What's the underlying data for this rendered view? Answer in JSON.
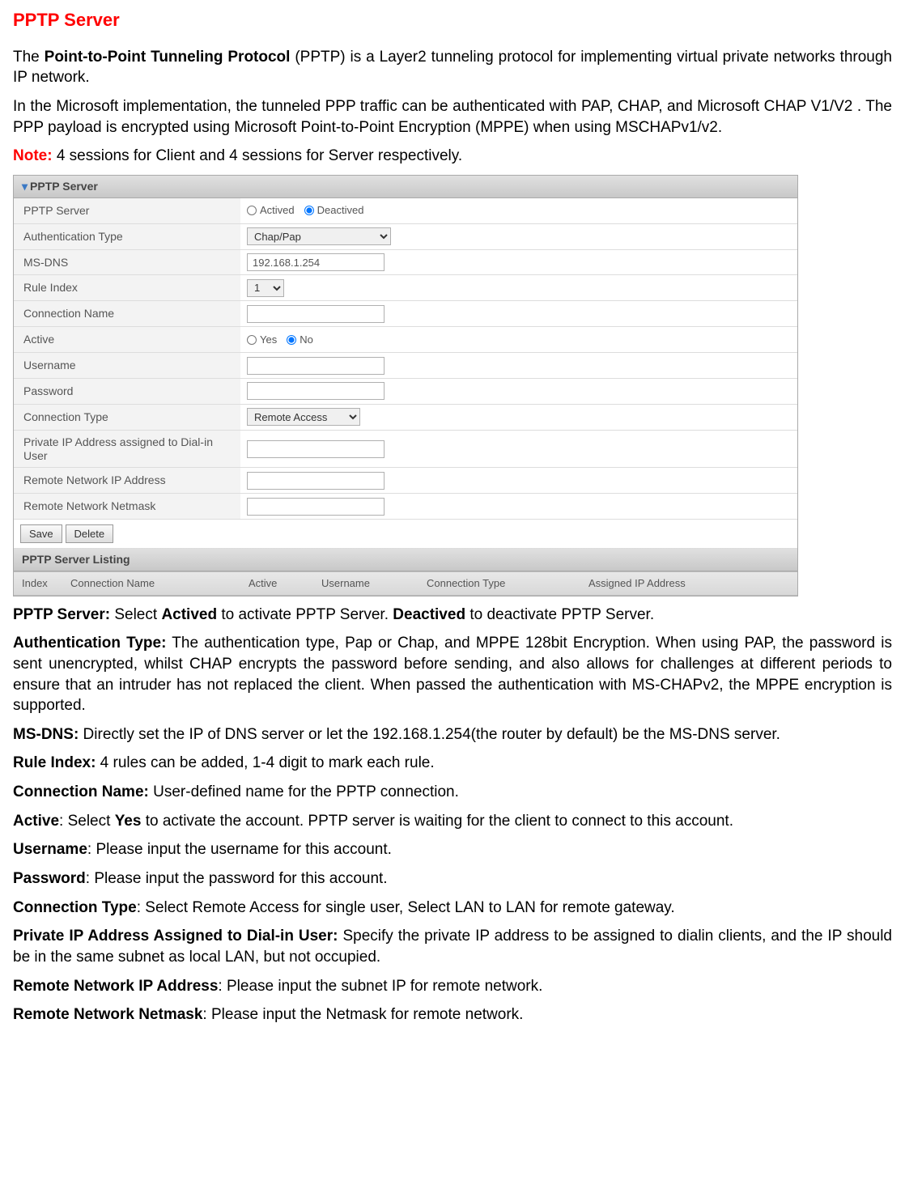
{
  "page_title": "PPTP Server",
  "intro_para1_prefix": "The ",
  "intro_para1_bold": "Point-to-Point Tunneling Protocol",
  "intro_para1_suffix": " (PPTP) is a Layer2 tunneling protocol for implementing virtual private networks through IP network.",
  "intro_para2": "In the Microsoft implementation, the tunneled PPP traffic can be authenticated with PAP, CHAP, and Microsoft CHAP V1/V2 . The PPP payload is encrypted using Microsoft Point-to-Point Encryption (MPPE) when using MSCHAPv1/v2.",
  "note_label": "Note:",
  "note_text": " 4 sessions for Client and 4 sessions for Server respectively.",
  "form": {
    "section_title": "PPTP Server",
    "rows": {
      "pptp_server_label": "PPTP Server",
      "actived_label": "Actived",
      "deactived_label": "Deactived",
      "auth_type_label": "Authentication Type",
      "auth_type_value": "Chap/Pap",
      "ms_dns_label": "MS-DNS",
      "ms_dns_value": "192.168.1.254",
      "rule_index_label": "Rule Index",
      "rule_index_value": "1",
      "connection_name_label": "Connection Name",
      "active_label": "Active",
      "yes_label": "Yes",
      "no_label": "No",
      "username_label": "Username",
      "password_label": "Password",
      "connection_type_label": "Connection Type",
      "connection_type_value": "Remote Access",
      "private_ip_label": "Private IP Address assigned to Dial-in User",
      "remote_ip_label": "Remote Network IP Address",
      "remote_netmask_label": "Remote Network Netmask"
    },
    "save_btn": "Save",
    "delete_btn": "Delete",
    "listing_title": "PPTP Server Listing",
    "table_headers": {
      "index": "Index",
      "conn_name": "Connection Name",
      "active": "Active",
      "username": "Username",
      "conn_type": "Connection Type",
      "assigned_ip": "Assigned IP Address"
    }
  },
  "descriptions": {
    "pptp_server_label": "PPTP Server:",
    "pptp_server_text1": " Select ",
    "pptp_server_bold1": "Actived",
    "pptp_server_text2": " to activate PPTP Server. ",
    "pptp_server_bold2": "Deactived",
    "pptp_server_text3": " to deactivate PPTP Server.",
    "auth_type_label": "Authentication Type:",
    "auth_type_text": " The authentication type, Pap or Chap, and MPPE 128bit Encryption. When using PAP, the password is sent unencrypted, whilst CHAP encrypts the password before sending, and also allows for challenges at different periods to ensure that an intruder has not replaced the client. When passed the authentication with MS-CHAPv2, the MPPE encryption is supported.",
    "ms_dns_label": "MS-DNS:",
    "ms_dns_text": " Directly set the IP of DNS server or let the 192.168.1.254(the router by default) be the MS-DNS server.",
    "rule_index_label": "Rule Index:",
    "rule_index_text": " 4 rules can be added, 1-4 digit to mark each rule.",
    "conn_name_label": "Connection Name:",
    "conn_name_text": " User-defined name for the PPTP connection.",
    "active_label": "Active",
    "active_text1": ": Select ",
    "active_bold1": "Yes",
    "active_text2": " to activate the account. PPTP server is waiting for the client to connect to this account.",
    "username_label": "Username",
    "username_text": ": Please input the username for this account.",
    "password_label": "Password",
    "password_text": ": Please input the password for this account.",
    "conn_type_label": "Connection Type",
    "conn_type_text": ": Select Remote Access for single user, Select LAN to LAN for remote gateway.",
    "private_ip_label": "Private IP Address Assigned to Dial-in User:",
    "private_ip_text": " Specify the private IP address to be assigned to dialin clients, and the IP should be in the same subnet as local LAN, but not occupied.",
    "remote_ip_label": "Remote Network IP Address",
    "remote_ip_text": ": Please input the subnet IP for remote network.",
    "remote_netmask_label": "Remote Network Netmask",
    "remote_netmask_text": ": Please input the Netmask for remote network."
  }
}
